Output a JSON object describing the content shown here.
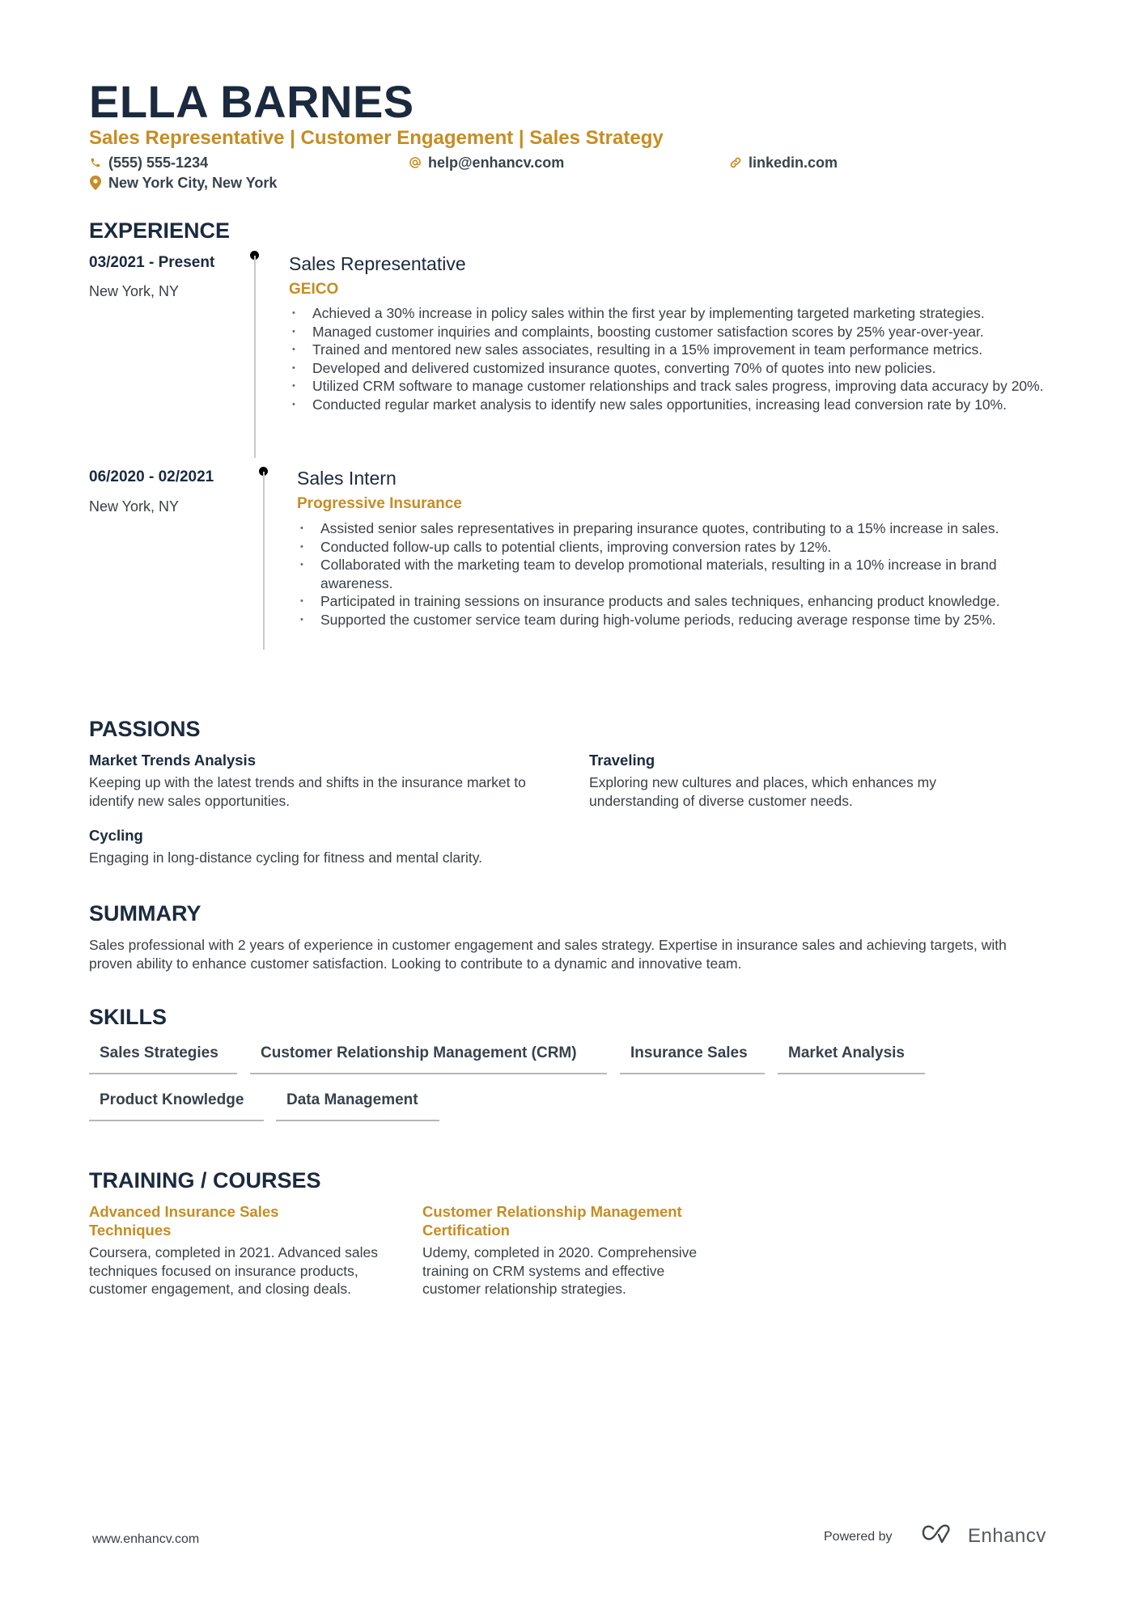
{
  "header": {
    "name": "ELLA BARNES",
    "subtitle": "Sales Representative | Customer Engagement | Sales Strategy",
    "contacts": {
      "phone": {
        "icon": "phone-icon",
        "value": "(555) 555-1234"
      },
      "email": {
        "icon": "at-icon",
        "value": "help@enhancv.com"
      },
      "linkedin": {
        "icon": "link-icon",
        "value": "linkedin.com"
      },
      "location": {
        "icon": "location-pin-icon",
        "value": "New York City, New York"
      }
    }
  },
  "colors": {
    "accent": "#c78c22",
    "heading": "#1b2a3e",
    "text": "#3a3f44",
    "divider": "#c8c8c8"
  },
  "experience": {
    "title": "EXPERIENCE",
    "items": [
      {
        "dates": "03/2021 - Present",
        "location": "New York, NY",
        "role": "Sales Representative",
        "company": "GEICO",
        "bullets": [
          "Achieved a 30% increase in policy sales within the first year by implementing targeted marketing strategies.",
          "Managed customer inquiries and complaints, boosting customer satisfaction scores by 25% year-over-year.",
          "Trained and mentored new sales associates, resulting in a 15% improvement in team performance metrics.",
          "Developed and delivered customized insurance quotes, converting 70% of quotes into new policies.",
          "Utilized CRM software to manage customer relationships and track sales progress, improving data accuracy by 20%.",
          "Conducted regular market analysis to identify new sales opportunities, increasing lead conversion rate by 10%."
        ]
      },
      {
        "dates": "06/2020 - 02/2021",
        "location": "New York, NY",
        "role": "Sales Intern",
        "company": "Progressive Insurance",
        "bullets": [
          "Assisted senior sales representatives in preparing insurance quotes, contributing to a 15% increase in sales.",
          "Conducted follow-up calls to potential clients, improving conversion rates by 12%.",
          "Collaborated with the marketing team to develop promotional materials, resulting in a 10% increase in brand awareness.",
          "Participated in training sessions on insurance products and sales techniques, enhancing product knowledge.",
          "Supported the customer service team during high-volume periods, reducing average response time by 25%."
        ]
      }
    ]
  },
  "passions": {
    "title": "PASSIONS",
    "items": [
      {
        "title": "Market Trends Analysis",
        "description": "Keeping up with the latest trends and shifts in the insurance market to identify new sales opportunities."
      },
      {
        "title": "Traveling",
        "description": "Exploring new cultures and places, which enhances my understanding of diverse customer needs."
      },
      {
        "title": "Cycling",
        "description": "Engaging in long-distance cycling for fitness and mental clarity."
      }
    ]
  },
  "summary": {
    "title": "SUMMARY",
    "text": "Sales professional with 2 years of experience in customer engagement and sales strategy. Expertise in insurance sales and achieving targets, with proven ability to enhance customer satisfaction. Looking to contribute to a dynamic and innovative team."
  },
  "skills": {
    "title": "SKILLS",
    "items": [
      "Sales Strategies",
      "Customer Relationship Management (CRM)",
      "Insurance Sales",
      "Market Analysis",
      "Product Knowledge",
      "Data Management"
    ]
  },
  "training": {
    "title": "TRAINING / COURSES",
    "items": [
      {
        "title": "Advanced Insurance Sales Techniques",
        "description": "Coursera, completed in 2021. Advanced sales techniques focused on insurance products, customer engagement, and closing deals."
      },
      {
        "title": "Customer Relationship Management Certification",
        "description": "Udemy, completed in 2020. Comprehensive training on CRM systems and effective customer relationship strategies."
      }
    ]
  },
  "footer": {
    "url": "www.enhancv.com",
    "powered_by": "Powered by",
    "brand": "Enhancv",
    "brand_icon": "enhancv-logo-icon"
  }
}
